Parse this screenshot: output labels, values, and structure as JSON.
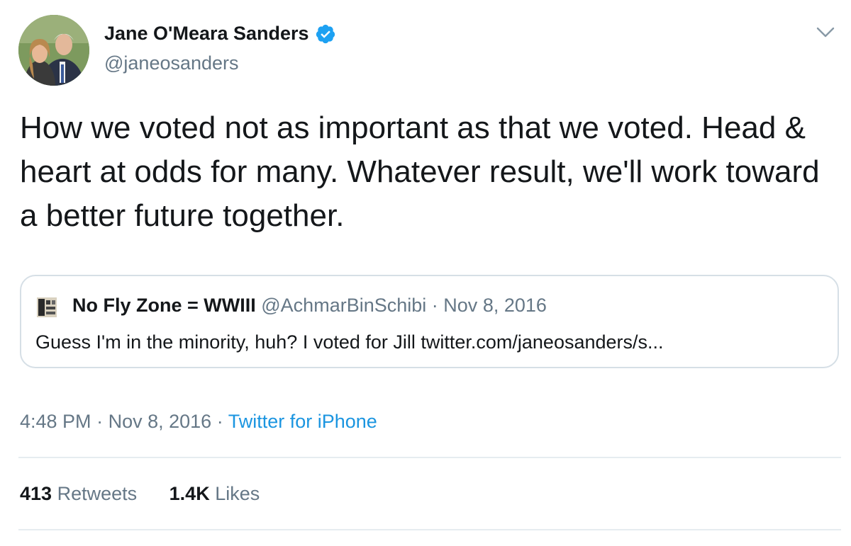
{
  "author": {
    "name": "Jane O'Meara Sanders",
    "handle": "@janeosanders",
    "verified": true
  },
  "tweet": {
    "text": "How we voted not as important as that we voted. Head & heart at odds for many. Whatever result, we'll work toward a better future together."
  },
  "quoted_tweet": {
    "name": "No Fly Zone = WWIII",
    "handle": "@AchmarBinSchibi",
    "separator": "·",
    "date": "Nov 8, 2016",
    "text": "Guess I'm in the minority, huh?  I voted for Jill twitter.com/janeosanders/s..."
  },
  "meta": {
    "time": "4:48 PM",
    "separator": "·",
    "date": "Nov 8, 2016",
    "source": "Twitter for iPhone"
  },
  "stats": {
    "retweets_count": "413",
    "retweets_label": "Retweets",
    "likes_count": "1.4K",
    "likes_label": "Likes"
  },
  "icons": {
    "verified": "verified-badge-icon",
    "caret": "chevron-down-icon"
  },
  "colors": {
    "text": "#14171a",
    "secondary": "#657786",
    "link": "#1b95e0",
    "verified": "#1da1f2",
    "border": "#d6dfe6",
    "divider": "#e6ecf0"
  }
}
